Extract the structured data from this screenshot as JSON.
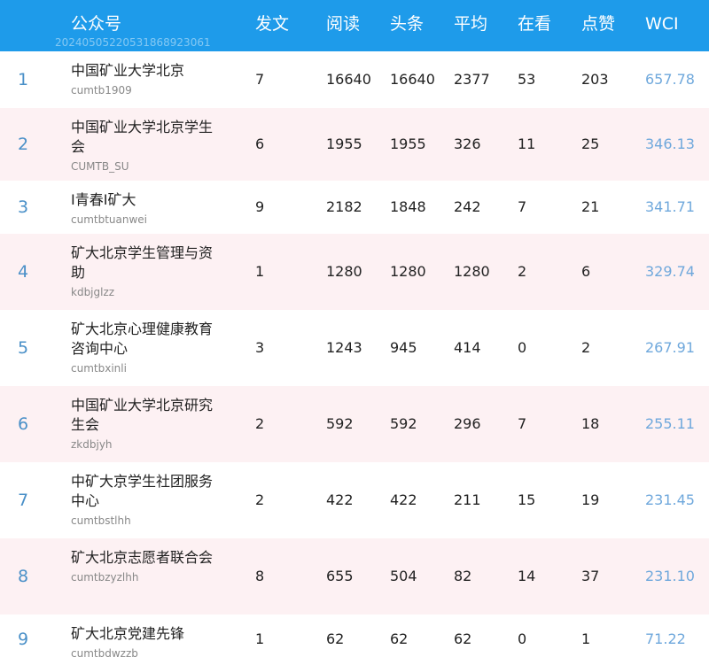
{
  "header": {
    "columns": [
      "公众号",
      "发文",
      "阅读",
      "头条",
      "平均",
      "在看",
      "点赞",
      "WCI"
    ],
    "watermark": "20240505220531868923061"
  },
  "rows": [
    {
      "rank": "1",
      "name": "中国矿业大学北京",
      "account": "cumtb1909",
      "posts": "7",
      "reads": "16640",
      "headline": "16640",
      "avg": "2377",
      "watching": "53",
      "likes": "203",
      "wci": "657.78"
    },
    {
      "rank": "2",
      "name": "中国矿业大学北京学生会",
      "account": "CUMTB_SU",
      "posts": "6",
      "reads": "1955",
      "headline": "1955",
      "avg": "326",
      "watching": "11",
      "likes": "25",
      "wci": "346.13"
    },
    {
      "rank": "3",
      "name": "I青春I矿大",
      "account": "cumtbtuanwei",
      "posts": "9",
      "reads": "2182",
      "headline": "1848",
      "avg": "242",
      "watching": "7",
      "likes": "21",
      "wci": "341.71"
    },
    {
      "rank": "4",
      "name": "矿大北京学生管理与资助",
      "account": "kdbjglzz",
      "posts": "1",
      "reads": "1280",
      "headline": "1280",
      "avg": "1280",
      "watching": "2",
      "likes": "6",
      "wci": "329.74"
    },
    {
      "rank": "5",
      "name": "矿大北京心理健康教育咨询中心",
      "account": "cumtbxinli",
      "posts": "3",
      "reads": "1243",
      "headline": "945",
      "avg": "414",
      "watching": "0",
      "likes": "2",
      "wci": "267.91"
    },
    {
      "rank": "6",
      "name": "中国矿业大学北京研究生会",
      "account": "zkdbjyh",
      "posts": "2",
      "reads": "592",
      "headline": "592",
      "avg": "296",
      "watching": "7",
      "likes": "18",
      "wci": "255.11"
    },
    {
      "rank": "7",
      "name": "中矿大京学生社团服务中心",
      "account": "cumtbstlhh",
      "posts": "2",
      "reads": "422",
      "headline": "422",
      "avg": "211",
      "watching": "15",
      "likes": "19",
      "wci": "231.45"
    },
    {
      "rank": "8",
      "name": "矿大北京志愿者联合会",
      "account": "cumtbzyzlhh",
      "posts": "8",
      "reads": "655",
      "headline": "504",
      "avg": "82",
      "watching": "14",
      "likes": "37",
      "wci": "231.10"
    },
    {
      "rank": "9",
      "name": "矿大北京党建先锋",
      "account": "cumtbdwzzb",
      "posts": "1",
      "reads": "62",
      "headline": "62",
      "avg": "62",
      "watching": "0",
      "likes": "1",
      "wci": "71.22"
    }
  ]
}
